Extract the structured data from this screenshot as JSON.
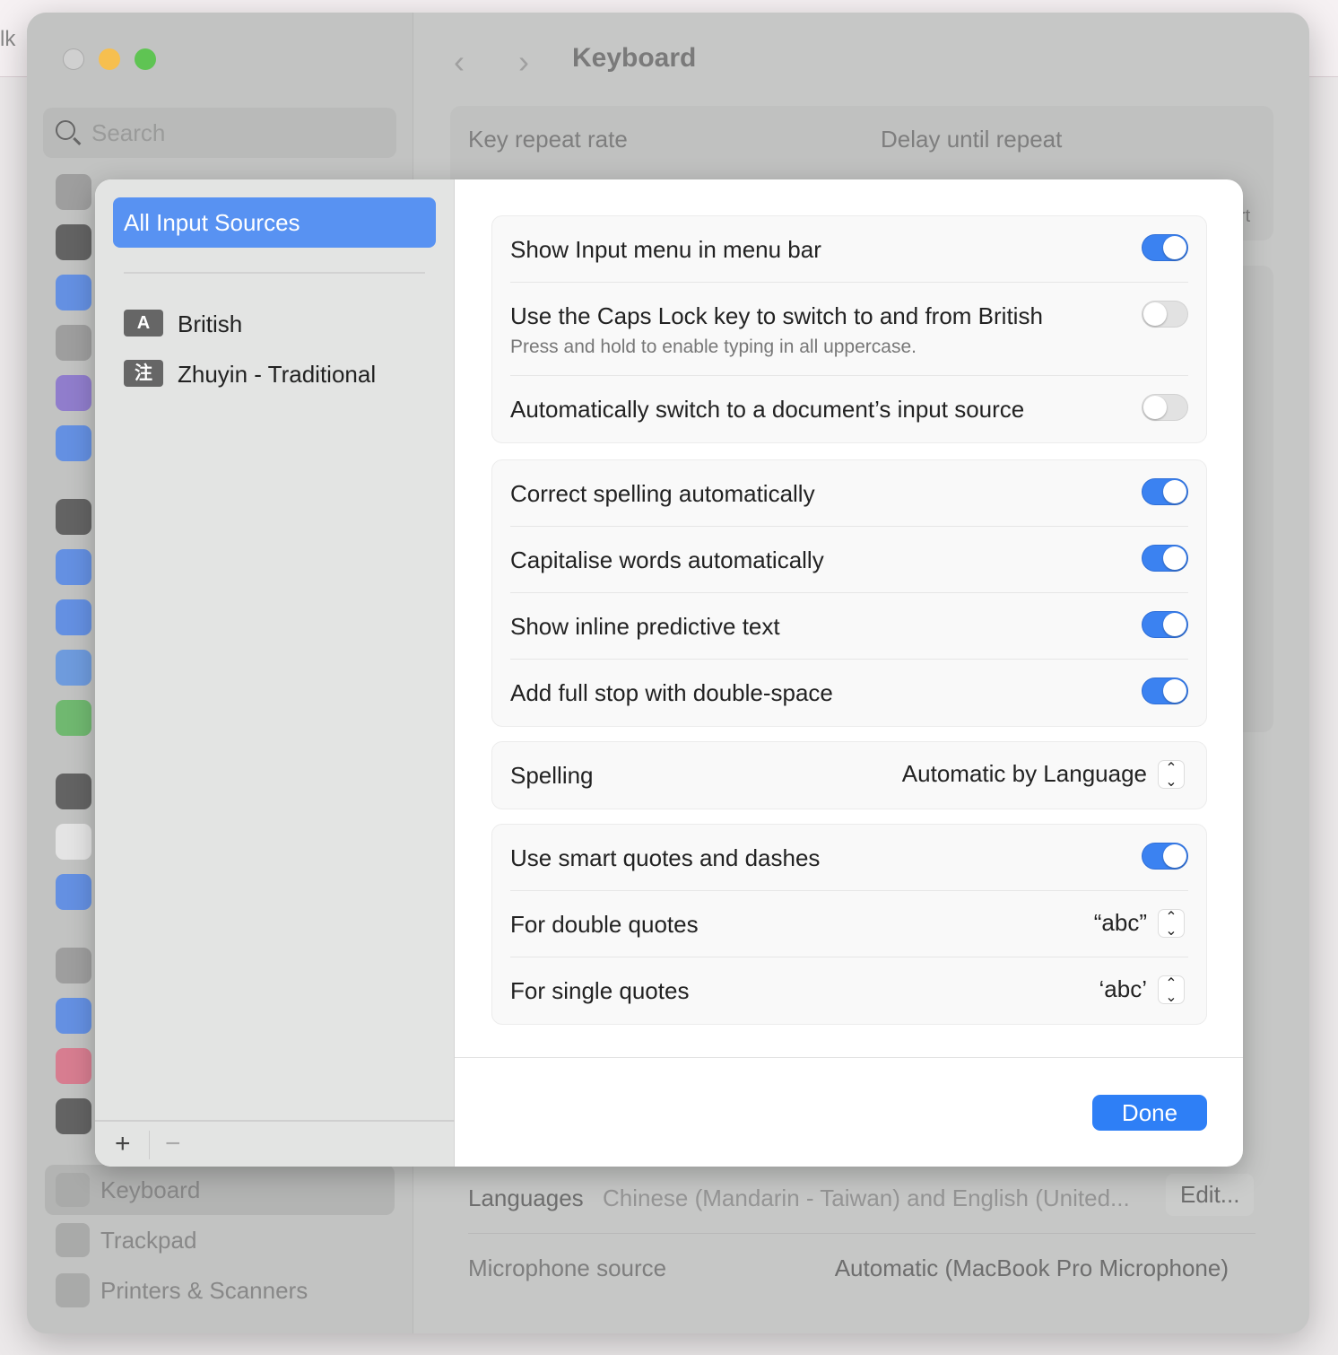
{
  "background": {
    "fragment": "lk"
  },
  "window": {
    "title": "Keyboard",
    "search_placeholder": "Search",
    "sidebar_items": [
      {
        "label": "Keyboard"
      },
      {
        "label": "Trackpad"
      },
      {
        "label": "Printers & Scanners"
      }
    ],
    "icon_colors": [
      "#8e8e8e",
      "#3a3a3a",
      "#3c7bf0",
      "#8e8e8e",
      "#7a5fd0",
      "#3c7bf0",
      "#3a3a3a",
      "#3c7bf0",
      "#3c7bf0",
      "#4a8ae8",
      "#4db34d",
      "#3a3a3a",
      "#f2f2f2",
      "#3c7bf0",
      "#8e8e8e",
      "#3c7bf0",
      "#e0607a",
      "#3a3a3a"
    ],
    "main": {
      "key_repeat_rate": "Key repeat rate",
      "delay_until_repeat": "Delay until repeat",
      "partial": "rt",
      "languages_label": "Languages",
      "languages_value": "Chinese (Mandarin - Taiwan) and English (United...",
      "edit_button": "Edit...",
      "microphone_label": "Microphone source",
      "microphone_value": "Automatic (MacBook Pro Microphone)"
    }
  },
  "sheet": {
    "all_input_sources": "All Input Sources",
    "sources": [
      {
        "badge": "A",
        "label": "British"
      },
      {
        "badge": "注",
        "label": "Zhuyin - Traditional"
      }
    ],
    "add": "+",
    "remove": "−",
    "groups": [
      [
        {
          "label": "Show Input menu in menu bar",
          "on": true
        },
        {
          "label": "Use the Caps Lock key to switch to and from British",
          "sub": "Press and hold to enable typing in all uppercase.",
          "on": false
        },
        {
          "label": "Automatically switch to a document’s input source",
          "on": false
        }
      ],
      [
        {
          "label": "Correct spelling automatically",
          "on": true
        },
        {
          "label": "Capitalise words automatically",
          "on": true
        },
        {
          "label": "Show inline predictive text",
          "on": true
        },
        {
          "label": "Add full stop with double-space",
          "on": true
        }
      ],
      [
        {
          "label": "Spelling",
          "value": "Automatic by Language"
        }
      ],
      [
        {
          "label": "Use smart quotes and dashes",
          "on": true
        },
        {
          "label": "For double quotes",
          "value": "“abc”"
        },
        {
          "label": "For single quotes",
          "value": "‘abc’"
        }
      ]
    ],
    "done": "Done",
    "accent": "#2e7ff6"
  }
}
